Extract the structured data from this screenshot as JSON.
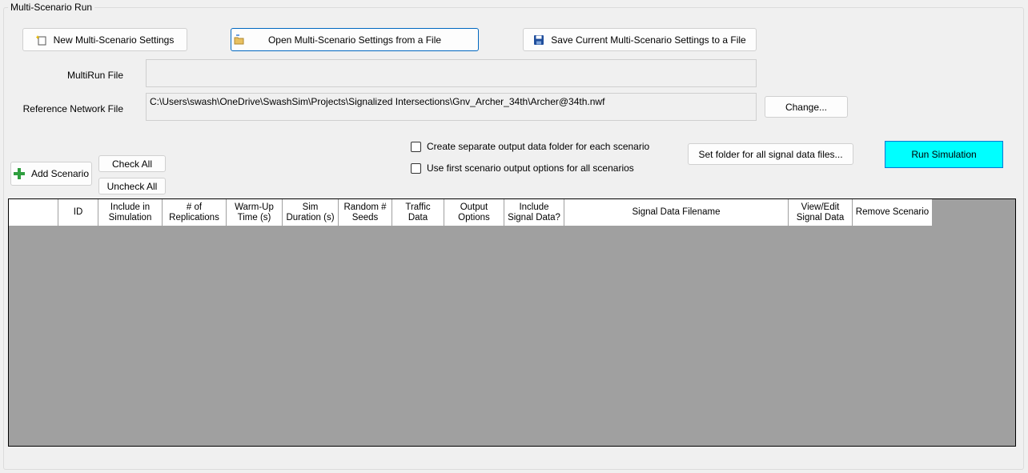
{
  "group": {
    "title": "Multi-Scenario Run"
  },
  "toolbar": {
    "new_label": "New Multi-Scenario Settings",
    "open_label": "Open Multi-Scenario Settings from a File",
    "save_label": "Save Current Multi-Scenario Settings to a File"
  },
  "files": {
    "multirun_label": "MultiRun File",
    "multirun_value": "",
    "reference_label": "Reference Network File",
    "reference_value": "C:\\Users\\swash\\OneDrive\\SwashSim\\Projects\\Signalized Intersections\\Gnv_Archer_34th\\Archer@34th.nwf",
    "change_label": "Change..."
  },
  "options": {
    "separate_folder_label": "Create separate output data folder for each scenario",
    "first_scenario_label": "Use first scenario output options for all scenarios",
    "set_folder_label": "Set folder for all signal data files...",
    "run_label": "Run Simulation"
  },
  "scenario_buttons": {
    "add_label": "Add Scenario",
    "check_all_label": "Check All",
    "uncheck_all_label": "Uncheck All"
  },
  "table": {
    "columns": [
      "",
      "ID",
      "Include in\nSimulation",
      "# of\nReplications",
      "Warm-Up\nTime (s)",
      "Sim\nDuration (s)",
      "Random #\nSeeds",
      "Traffic\nData",
      "Output\nOptions",
      "Include\nSignal Data?",
      "Signal Data Filename",
      "View/Edit\nSignal Data",
      "Remove Scenario"
    ]
  },
  "colors": {
    "run_button": "#00ffff",
    "grid_background": "#a0a0a0",
    "add_icon": "#2e9e3e"
  },
  "icons": [
    "new-settings-icon",
    "open-folder-icon",
    "save-disk-icon",
    "plus-icon"
  ]
}
